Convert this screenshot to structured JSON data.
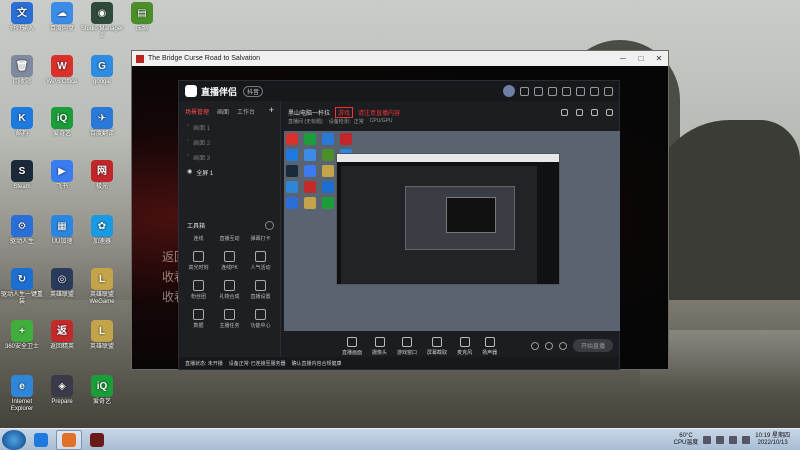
{
  "desktop": {
    "icons": [
      {
        "label": "好好输入",
        "color": "#2a6fd6",
        "glyph": "文"
      },
      {
        "label": "百度网盘",
        "color": "#3c8be6",
        "glyph": "☁"
      },
      {
        "label": "Studio Manager 2",
        "color": "#2f4a3a",
        "glyph": "◉"
      },
      {
        "label": "压缩",
        "color": "#4b8f2a",
        "glyph": "▤"
      },
      {
        "label": "回收站",
        "color": "#7f8aa0",
        "glyph": "🗑"
      },
      {
        "label": "WPS Office",
        "color": "#d9312b",
        "glyph": "W"
      },
      {
        "label": "google",
        "color": "#2d8be0",
        "glyph": "G"
      },
      {
        "label": "酷狗",
        "color": "#1f7ae0",
        "glyph": "K"
      },
      {
        "label": "爱奇艺",
        "color": "#1b9d3a",
        "glyph": "iQ"
      },
      {
        "label": "百度翻译",
        "color": "#2a78d8",
        "glyph": "✈"
      },
      {
        "label": "Steam",
        "color": "#1a2a3a",
        "glyph": "S"
      },
      {
        "label": "飞书",
        "color": "#3a7bf0",
        "glyph": "▶"
      },
      {
        "label": "极光",
        "color": "#c3262a",
        "glyph": "网"
      },
      {
        "label": "驱动人生",
        "color": "#2a6ed8",
        "glyph": "⚙"
      },
      {
        "label": "UU加速",
        "color": "#2a86e0",
        "glyph": "▦"
      },
      {
        "label": "加速器",
        "color": "#1a9ae0",
        "glyph": "✿"
      },
      {
        "label": "驱动人生一键重装",
        "color": "#1c6fd0",
        "glyph": "↻"
      },
      {
        "label": "英雄联盟",
        "color": "#2a3a5a",
        "glyph": "◎"
      },
      {
        "label": "英雄联盟 WeGame",
        "color": "#c4a44a",
        "glyph": "L"
      },
      {
        "label": "360安全卫士",
        "color": "#3fae3a",
        "glyph": "+"
      },
      {
        "label": "返回精英",
        "color": "#c32a2a",
        "glyph": "返"
      },
      {
        "label": "英雄联盟",
        "color": "#c4a44a",
        "glyph": "L"
      },
      {
        "label": "Internet Explorer",
        "color": "#2f86d6",
        "glyph": "e"
      },
      {
        "label": "Prepare",
        "color": "#3a3a4a",
        "glyph": "◈"
      },
      {
        "label": "爱奇艺",
        "color": "#1b9d3a",
        "glyph": "iQ"
      }
    ]
  },
  "window": {
    "title": "The Bridge Curse Road to Salvation",
    "deco_lines": [
      "返回",
      "收看",
      "收看"
    ]
  },
  "app": {
    "name": "直播伴侣",
    "badge": "抖音",
    "tabs": [
      "场景管理",
      "画面",
      "工作台"
    ],
    "tab_plus": "+",
    "scenes": [
      "画面 1",
      "画面 2",
      "画面 3",
      "全屏 1"
    ],
    "toolbox_title": "工具箱",
    "tools": [
      "连线",
      "直播互动",
      "弹幕打卡",
      "高光时刻",
      "连线PK",
      "人气活动",
      "粉丝团",
      "礼物合成",
      "直播设置",
      "数据",
      "主播任务",
      "功能中心"
    ],
    "room": {
      "title": "黑山电脑一杆拉",
      "tag": "游戏",
      "warning": "请注意直播内容",
      "sub": [
        "直播间 (无标题)",
        "设备检测：正常",
        "CPU/GPU"
      ]
    },
    "controls": [
      "直播画面",
      "摄像头",
      "游戏窗口",
      "屏幕截取",
      "麦克风",
      "扬声器"
    ],
    "start_label": "开始直播",
    "status": [
      "直播状态: 未开播",
      "设备正常·已连接至服务器",
      "确认直播内容合规健康"
    ]
  },
  "taskbar": {
    "items": [
      "酷狗",
      "直播伴侣",
      "游戏"
    ],
    "temperature": "60°C",
    "cpu_label": "CPU温度",
    "time": "10:19",
    "weekday": "星期四",
    "date": "2022/10/13"
  }
}
